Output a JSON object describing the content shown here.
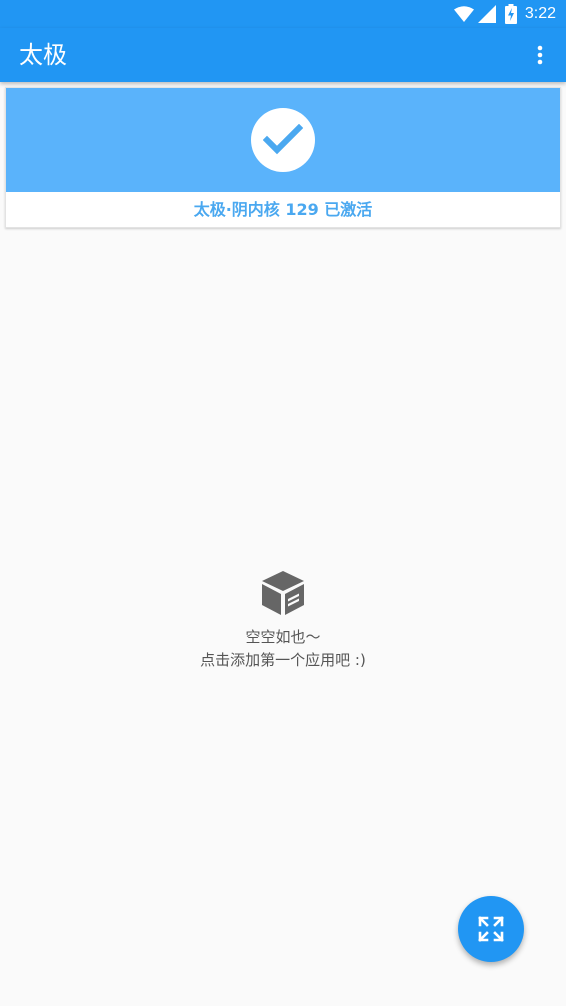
{
  "status_bar": {
    "time": "3:22",
    "icons": [
      "wifi-icon",
      "cellular-signal-icon",
      "battery-charging-icon"
    ]
  },
  "app_bar": {
    "title": "太极",
    "overflow_icon": "more-vert-icon"
  },
  "status_card": {
    "icon": "check-circle-icon",
    "label": "太极·阴内核 129 已激活",
    "banner_color": "#5ab3fb",
    "label_color": "#4aa8f0"
  },
  "empty_state": {
    "icon": "package-icon",
    "line1": "空空如也～",
    "line2": "点击添加第一个应用吧 :)"
  },
  "fab": {
    "icon": "expand-arrows-icon"
  },
  "colors": {
    "primary": "#2196f3",
    "background": "#fafafa"
  }
}
